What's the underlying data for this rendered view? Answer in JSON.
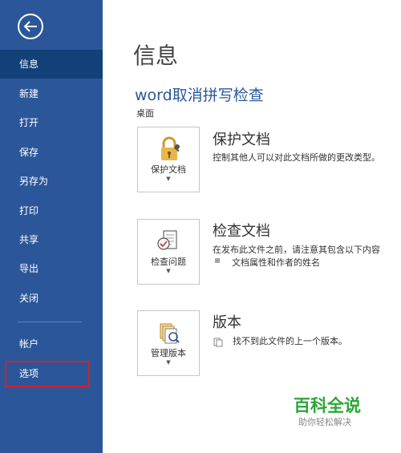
{
  "nav": {
    "items": [
      {
        "label": "信息",
        "active": true
      },
      {
        "label": "新建"
      },
      {
        "label": "打开"
      },
      {
        "label": "保存"
      },
      {
        "label": "另存为"
      },
      {
        "label": "打印"
      },
      {
        "label": "共享"
      },
      {
        "label": "导出"
      },
      {
        "label": "关闭"
      }
    ],
    "account_label": "帐户",
    "options_label": "选项"
  },
  "main": {
    "page_title": "信息",
    "doc_title": "word取消拼写检查",
    "doc_location": "桌面"
  },
  "sections": {
    "protect": {
      "button_label": "保护文档",
      "heading": "保护文档",
      "description": "控制其他人可以对此文档所做的更改类型。"
    },
    "inspect": {
      "button_label": "检查问题",
      "heading": "检查文档",
      "description": "在发布此文件之前，请注意其包含以下内容",
      "bullet": "文档属性和作者的姓名"
    },
    "versions": {
      "button_label": "管理版本",
      "heading": "版本",
      "description": "找不到此文件的上一个版本。"
    }
  },
  "watermark": {
    "title": "百科全说",
    "subtitle": "助你轻松解决"
  },
  "colors": {
    "sidebar": "#2b579a",
    "sidebar_active": "#124078",
    "highlight": "#d6202a",
    "accent": "#2b579a"
  }
}
